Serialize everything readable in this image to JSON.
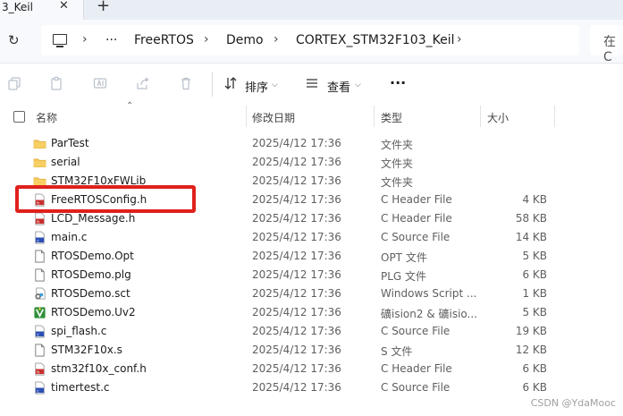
{
  "tab": {
    "title": "3_Keil",
    "close": "✕",
    "new": "+"
  },
  "address": {
    "overflow": "···",
    "crumbs": [
      "FreeRTOS",
      "Demo",
      "CORTEX_STM32F103_Keil"
    ],
    "search_partial": "在 C"
  },
  "toolbar": {
    "sort_label": "排序",
    "view_label": "查看",
    "more_label": "···"
  },
  "columns": {
    "name": "名称",
    "date": "修改日期",
    "type": "类型",
    "size": "大小"
  },
  "files": [
    {
      "name": "ParTest",
      "date": "2025/4/12 17:36",
      "type": "文件夹",
      "size": "",
      "icon": "folder-icon"
    },
    {
      "name": "serial",
      "date": "2025/4/12 17:36",
      "type": "文件夹",
      "size": "",
      "icon": "folder-icon"
    },
    {
      "name": "STM32F10xFWLib",
      "date": "2025/4/12 17:36",
      "type": "文件夹",
      "size": "",
      "icon": "folder-icon"
    },
    {
      "name": "FreeRTOSConfig.h",
      "date": "2025/4/12 17:36",
      "type": "C Header File",
      "size": "4 KB",
      "icon": "h-file-icon"
    },
    {
      "name": "LCD_Message.h",
      "date": "2025/4/12 17:36",
      "type": "C Header File",
      "size": "58 KB",
      "icon": "h-file-icon"
    },
    {
      "name": "main.c",
      "date": "2025/4/12 17:36",
      "type": "C Source File",
      "size": "14 KB",
      "icon": "c-file-icon"
    },
    {
      "name": "RTOSDemo.Opt",
      "date": "2025/4/12 17:36",
      "type": "OPT 文件",
      "size": "5 KB",
      "icon": "blank-file-icon"
    },
    {
      "name": "RTOSDemo.plg",
      "date": "2025/4/12 17:36",
      "type": "PLG 文件",
      "size": "6 KB",
      "icon": "blank-file-icon"
    },
    {
      "name": "RTOSDemo.sct",
      "date": "2025/4/12 17:36",
      "type": "Windows Script ...",
      "size": "1 KB",
      "icon": "script-file-icon"
    },
    {
      "name": "RTOSDemo.Uv2",
      "date": "2025/4/12 17:36",
      "type": "礦ision2 & 礦isio...",
      "size": "5 KB",
      "icon": "keil-project-icon"
    },
    {
      "name": "spi_flash.c",
      "date": "2025/4/12 17:36",
      "type": "C Source File",
      "size": "19 KB",
      "icon": "c-file-icon"
    },
    {
      "name": "STM32F10x.s",
      "date": "2025/4/12 17:36",
      "type": "S 文件",
      "size": "12 KB",
      "icon": "blank-file-icon"
    },
    {
      "name": "stm32f10x_conf.h",
      "date": "2025/4/12 17:36",
      "type": "C Header File",
      "size": "6 KB",
      "icon": "h-file-icon"
    },
    {
      "name": "timertest.c",
      "date": "2025/4/12 17:36",
      "type": "C Source File",
      "size": "6 KB",
      "icon": "c-file-icon"
    }
  ],
  "watermark": "CSDN @YdaMooc",
  "colors": {
    "highlight": "#e0201b",
    "folder": "#f2c14e",
    "c_file": "#2b4fb4",
    "h_file": "#c8302e"
  }
}
